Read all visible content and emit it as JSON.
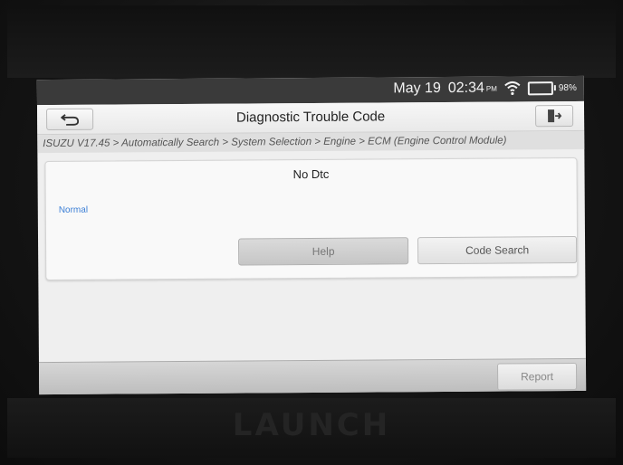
{
  "status_bar": {
    "date": "May 19",
    "time": "02:34",
    "ampm": "PM",
    "battery_percent": "98%",
    "icons": [
      "wifi-icon",
      "battery-icon"
    ]
  },
  "header": {
    "title": "Diagnostic Trouble Code",
    "back_icon": "back-arrow-icon",
    "exit_icon": "exit-icon"
  },
  "breadcrumb": "ISUZU V17.45 > Automatically Search > System Selection > Engine > ECM (Engine Control Module)",
  "result": {
    "message": "No Dtc",
    "status": "Normal"
  },
  "actions": {
    "help_label": "Help",
    "code_search_label": "Code Search"
  },
  "footer": {
    "report_label": "Report"
  },
  "colors": {
    "status_bar_bg": "#3a3a3a",
    "normal_text": "#3c7fd6",
    "screen_bg": "#efefef"
  }
}
